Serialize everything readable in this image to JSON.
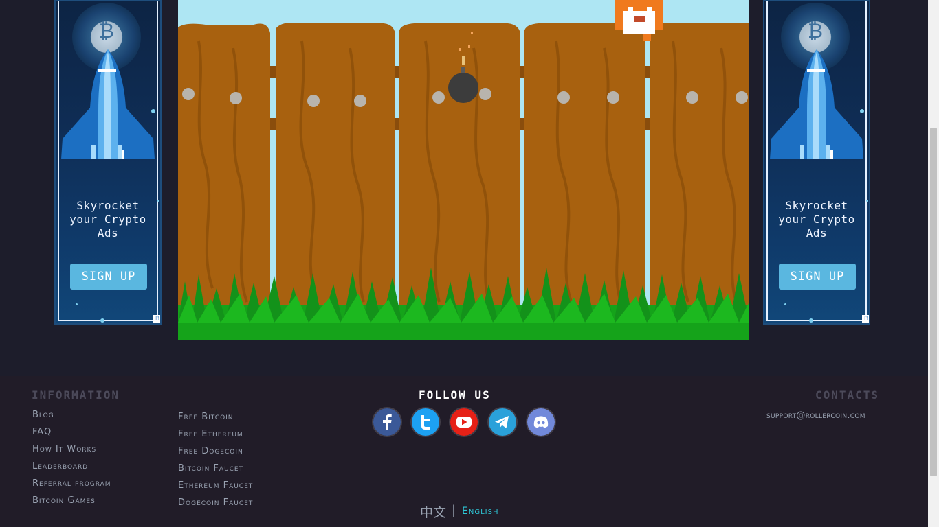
{
  "ads": {
    "left": {
      "headline": "Skyrocket\nyour Crypto\nAds",
      "button": "SIGN UP",
      "coin_symbol": "₿",
      "badge": "B"
    },
    "right": {
      "headline": "Skyrocket\nyour Crypto\nAds",
      "button": "SIGN UP",
      "coin_symbol": "₿",
      "badge": "B"
    }
  },
  "footer": {
    "information": {
      "heading": "INFORMATION",
      "links": [
        "Blog",
        "FAQ",
        "How It Works",
        "Leaderboard",
        "Referral program",
        "Bitcoin Games"
      ]
    },
    "faucets": {
      "links": [
        "Free Bitcoin",
        "Free Ethereum",
        "Free Dogecoin",
        "Bitcoin Faucet",
        "Ethereum Faucet",
        "Dogecoin Faucet"
      ]
    },
    "follow": {
      "heading": "FOLLOW US",
      "networks": [
        "facebook-icon",
        "twitter-icon",
        "youtube-icon",
        "telegram-icon",
        "discord-icon"
      ]
    },
    "contacts": {
      "heading": "CONTACTS",
      "email": "support@rollercoin.com"
    },
    "languages": {
      "chinese": "中文",
      "english": "English",
      "separator": "|"
    }
  },
  "colors": {
    "heading_muted": "#4c4a5a",
    "heading_bright": "#ffffff",
    "link": "#9aa3b2",
    "english_active": "#2ec6d6",
    "fence": "#a8610f",
    "sky": "#aee6f3",
    "grass": "#15a31a"
  }
}
